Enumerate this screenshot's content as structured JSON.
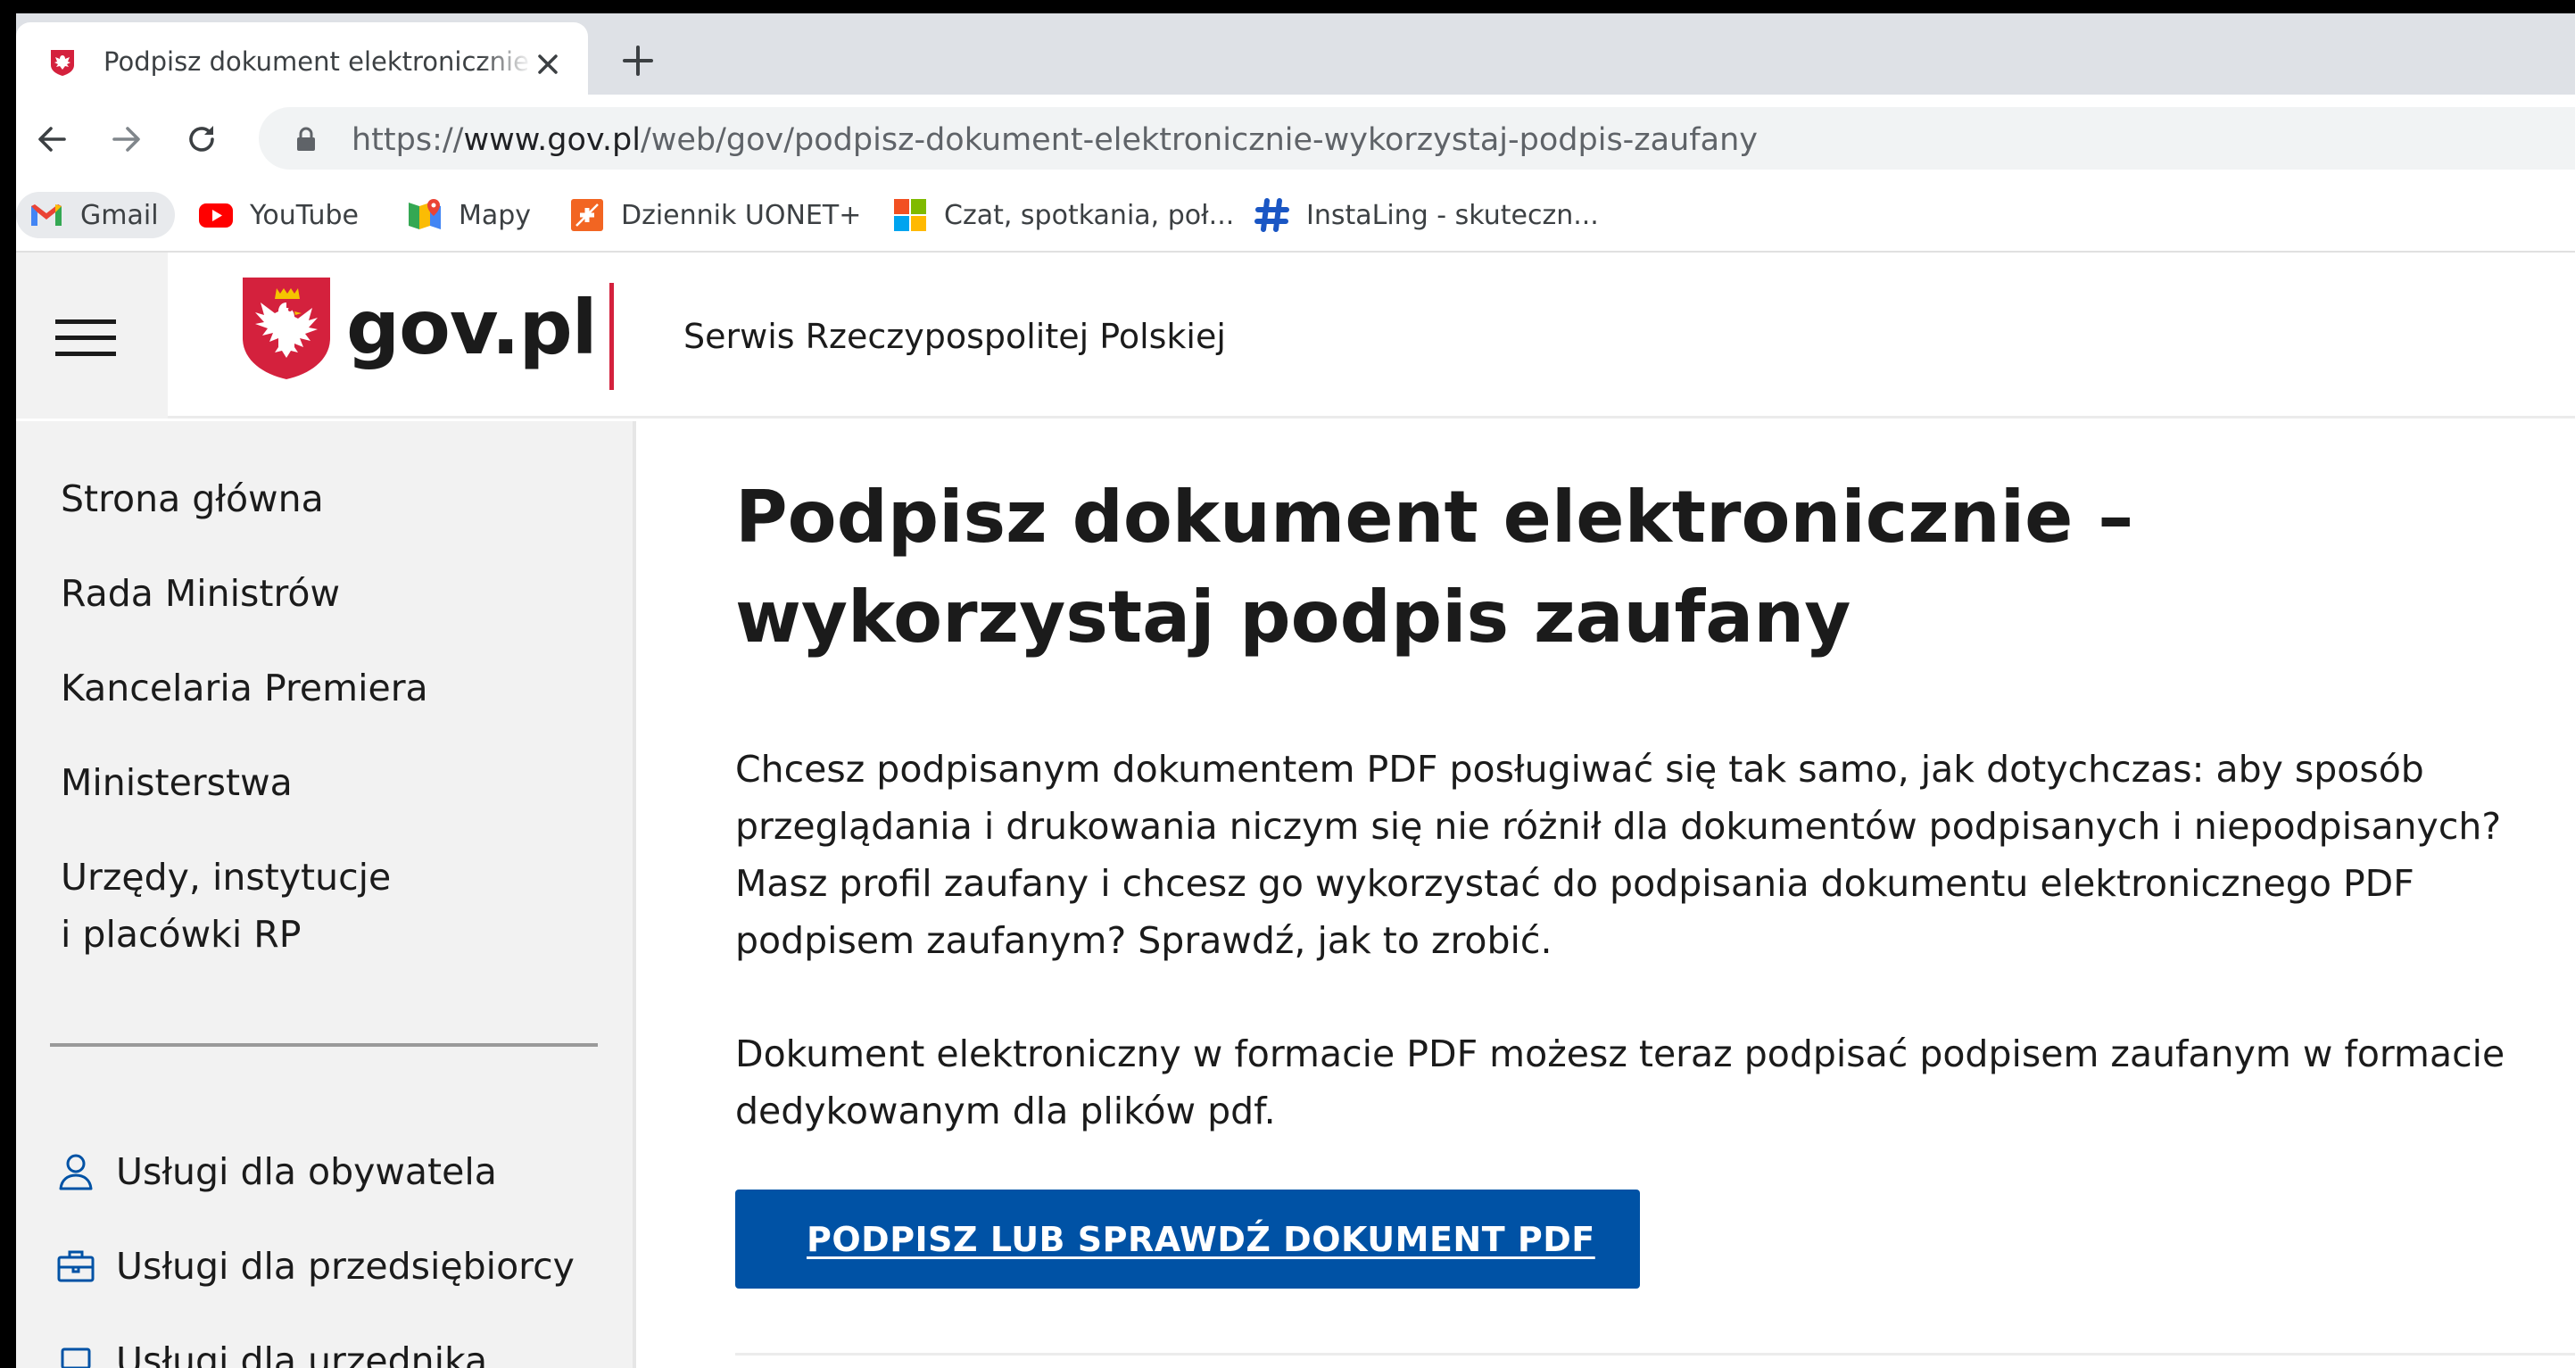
{
  "browser": {
    "tab": {
      "title": "Podpisz dokument elektronicznie – wykorzystaj podpis zaufany"
    },
    "url": {
      "scheme": "https://",
      "host": "www.gov.pl",
      "path": "/web/gov/podpisz-dokument-elektronicznie-wykorzystaj-podpis-zaufany"
    },
    "bookmarks": [
      {
        "label": "Gmail",
        "icon": "gmail-icon"
      },
      {
        "label": "YouTube",
        "icon": "youtube-icon"
      },
      {
        "label": "Mapy",
        "icon": "maps-icon"
      },
      {
        "label": "Dziennik UONET+",
        "icon": "uonet-icon"
      },
      {
        "label": "Czat, spotkania, poł...",
        "icon": "microsoft-icon"
      },
      {
        "label": "InstaLing - skuteczn...",
        "icon": "instaling-icon"
      }
    ]
  },
  "site": {
    "logo": "gov.pl",
    "service_name": "Serwis Rzeczypospolitej Polskiej",
    "accent_color": "#d4213d",
    "primary_color": "#0052a5"
  },
  "sidebar": {
    "links": [
      {
        "label": "Strona główna"
      },
      {
        "label": "Rada Ministrów"
      },
      {
        "label": "Kancelaria Premiera"
      },
      {
        "label": "Ministerstwa"
      },
      {
        "label": "Urzędy, instytucje\ni placówki RP"
      }
    ],
    "services": [
      {
        "label": "Usługi dla obywatela",
        "icon": "person-icon"
      },
      {
        "label": "Usługi dla przedsiębiorcy",
        "icon": "briefcase-icon"
      },
      {
        "label": "Usługi dla urzędnika",
        "icon": "laptop-icon"
      }
    ]
  },
  "main": {
    "title": "Podpisz dokument elektronicznie – wykorzystaj podpis zaufany",
    "paragraphs": [
      "Chcesz podpisanym dokumentem PDF posługiwać się tak samo, jak dotychczas: aby sposób przeglądania i drukowania niczym się nie różnił dla dokumentów podpisanych i niepodpisanych? Masz profil zaufany i chcesz go wykorzystać do podpisania dokumentu elektronicznego PDF podpisem zaufanym? Sprawdź, jak to zrobić.",
      "Dokument elektroniczny w formacie PDF możesz teraz podpisać podpisem zaufanym w formacie dedykowanym dla plików pdf."
    ],
    "cta_label": "PODPISZ LUB SPRAWDŹ DOKUMENT PDF"
  }
}
